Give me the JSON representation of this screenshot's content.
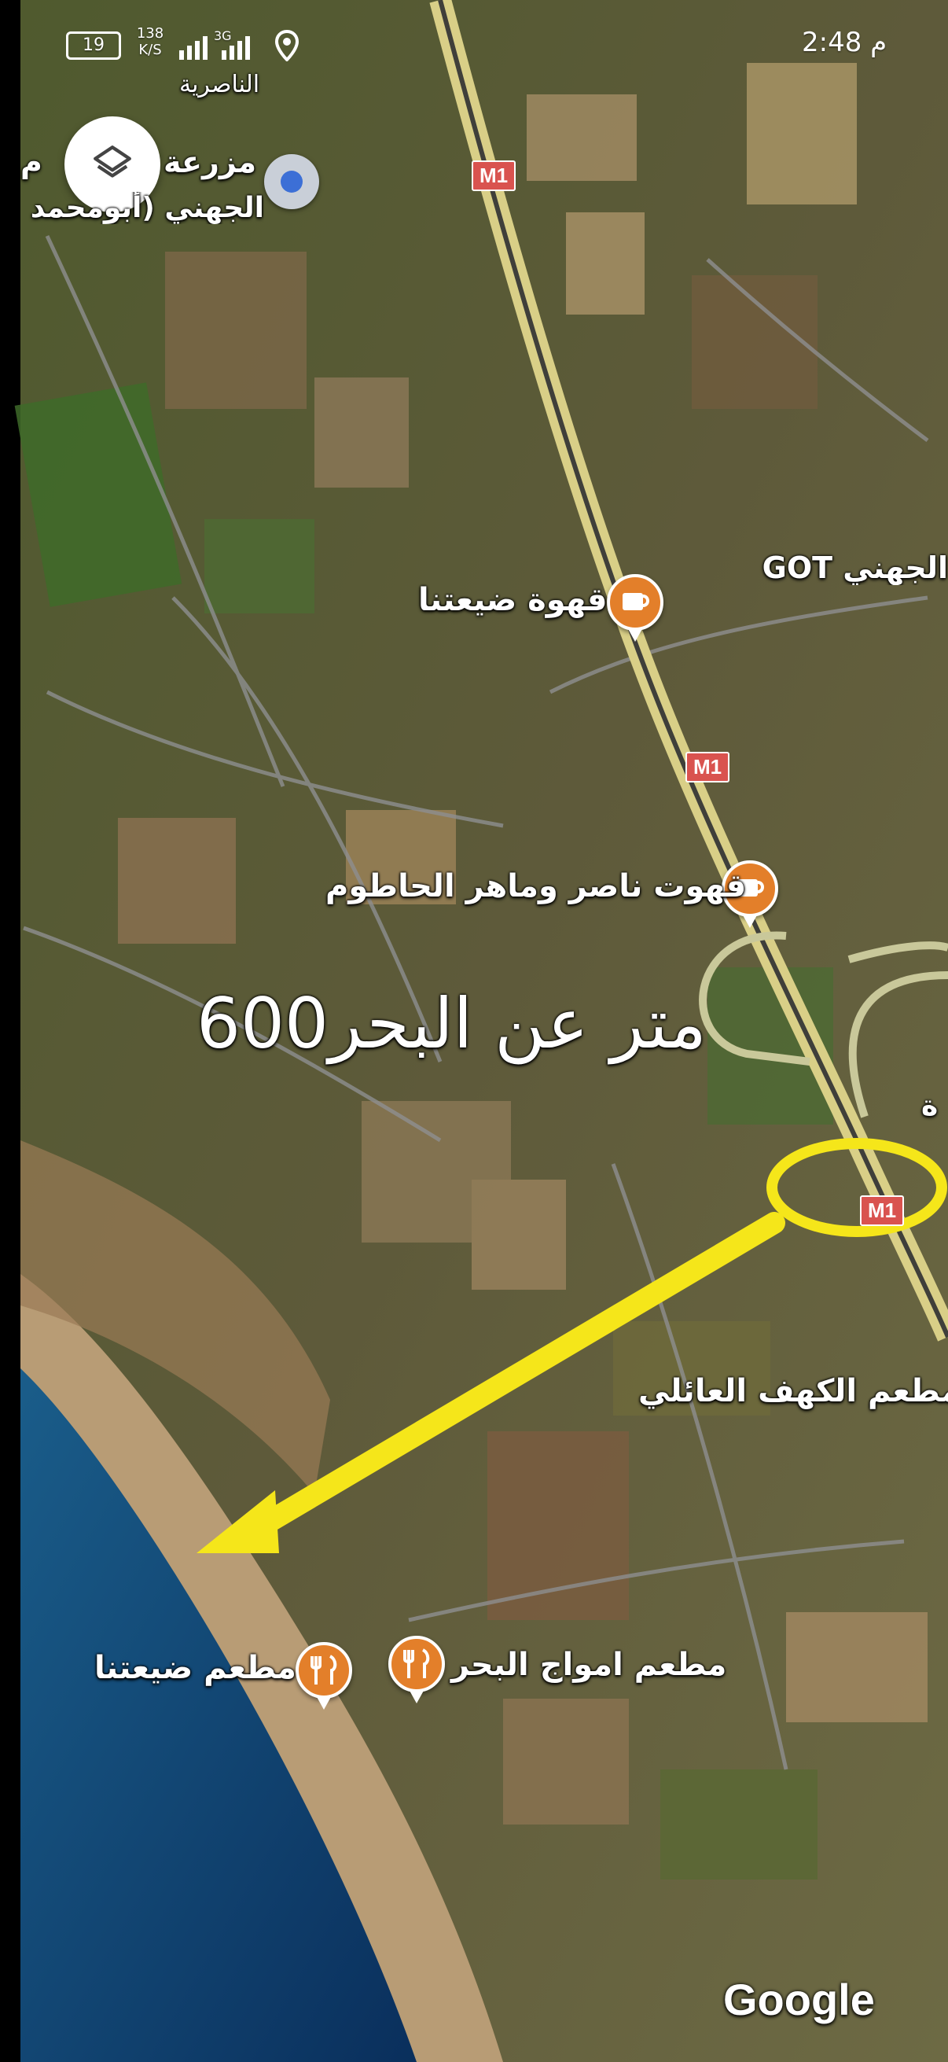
{
  "status_bar": {
    "battery": "19",
    "speed_value": "138",
    "speed_unit": "K/S",
    "network": "3G",
    "time": "2:48 م"
  },
  "map": {
    "places": {
      "nasiriya": "الناصرية",
      "farm_line1": "مزرعة",
      "farm_line2": "الجهني (أبومحمد",
      "farm_partial": "م",
      "jihni_got": "الجهني GOT",
      "cafe_daiatna": "قهوة ضيعتنا",
      "cafe_nasser": "قهوت ناصر وماهر الحاطوم",
      "restaurant_cave": "مطعم الكهف العائلي",
      "restaurant_waves": "مطعم امواج البحر",
      "restaurant_daiatna": "مطعم ضيعتنا",
      "edge_char": "ة"
    },
    "road_label": "M1",
    "annotation": "600متر عن البحر",
    "attribution": "Google"
  },
  "icons": {
    "layers": "layers-icon",
    "cafe": "coffee-cup-icon",
    "restaurant": "fork-knife-icon",
    "location": "location-pin-icon",
    "selected_place": "place-marker-icon"
  },
  "colors": {
    "highlight": "#f5e61a",
    "poi": "#e37f2a",
    "road": "#d9534f",
    "sea": "#0d3a6b"
  }
}
